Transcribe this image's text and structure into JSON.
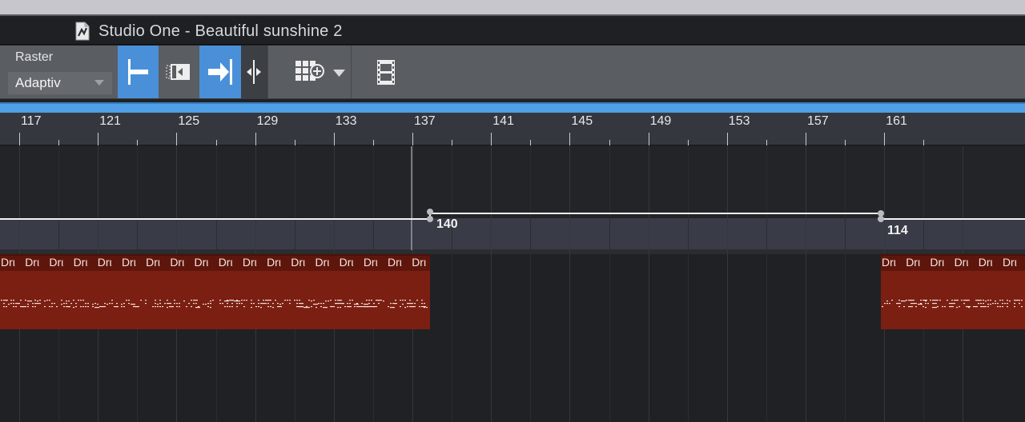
{
  "window": {
    "title": "Studio One - Beautiful sunshine 2"
  },
  "toolbar": {
    "raster_label": "Raster",
    "raster_value": "Adaptiv",
    "buttons": [
      {
        "name": "snap-to-start-button",
        "icon": "snap-left-bar-icon",
        "active": true
      },
      {
        "name": "snap-to-event-button",
        "icon": "snap-event-icon",
        "active": false
      },
      {
        "name": "snap-to-cursor-button",
        "icon": "arrow-to-bar-icon",
        "active": true
      },
      {
        "name": "snap-split-button",
        "icon": "split-arrows-icon",
        "active": false
      },
      {
        "name": "grid-plus-button",
        "icon": "grid-plus-icon",
        "active": false
      },
      {
        "name": "grid-options-dropdown",
        "icon": "chevron-down-icon",
        "active": false
      },
      {
        "name": "video-button",
        "icon": "film-icon",
        "active": false
      }
    ],
    "accent_color": "#4a90d8"
  },
  "ruler": {
    "bars": [
      "117",
      "121",
      "125",
      "129",
      "133",
      "137",
      "141",
      "145",
      "149",
      "153",
      "157",
      "161"
    ]
  },
  "tempo": {
    "points": [
      {
        "bar": 133,
        "bpm": "140"
      },
      {
        "bar": 157,
        "bpm": "114"
      }
    ]
  },
  "track": {
    "event_color": "#7b1f12",
    "events": [
      {
        "name": "Drum",
        "label": "Drι",
        "count": 18
      },
      {
        "name": "Drum",
        "label": "Drι",
        "count": 6
      }
    ]
  }
}
